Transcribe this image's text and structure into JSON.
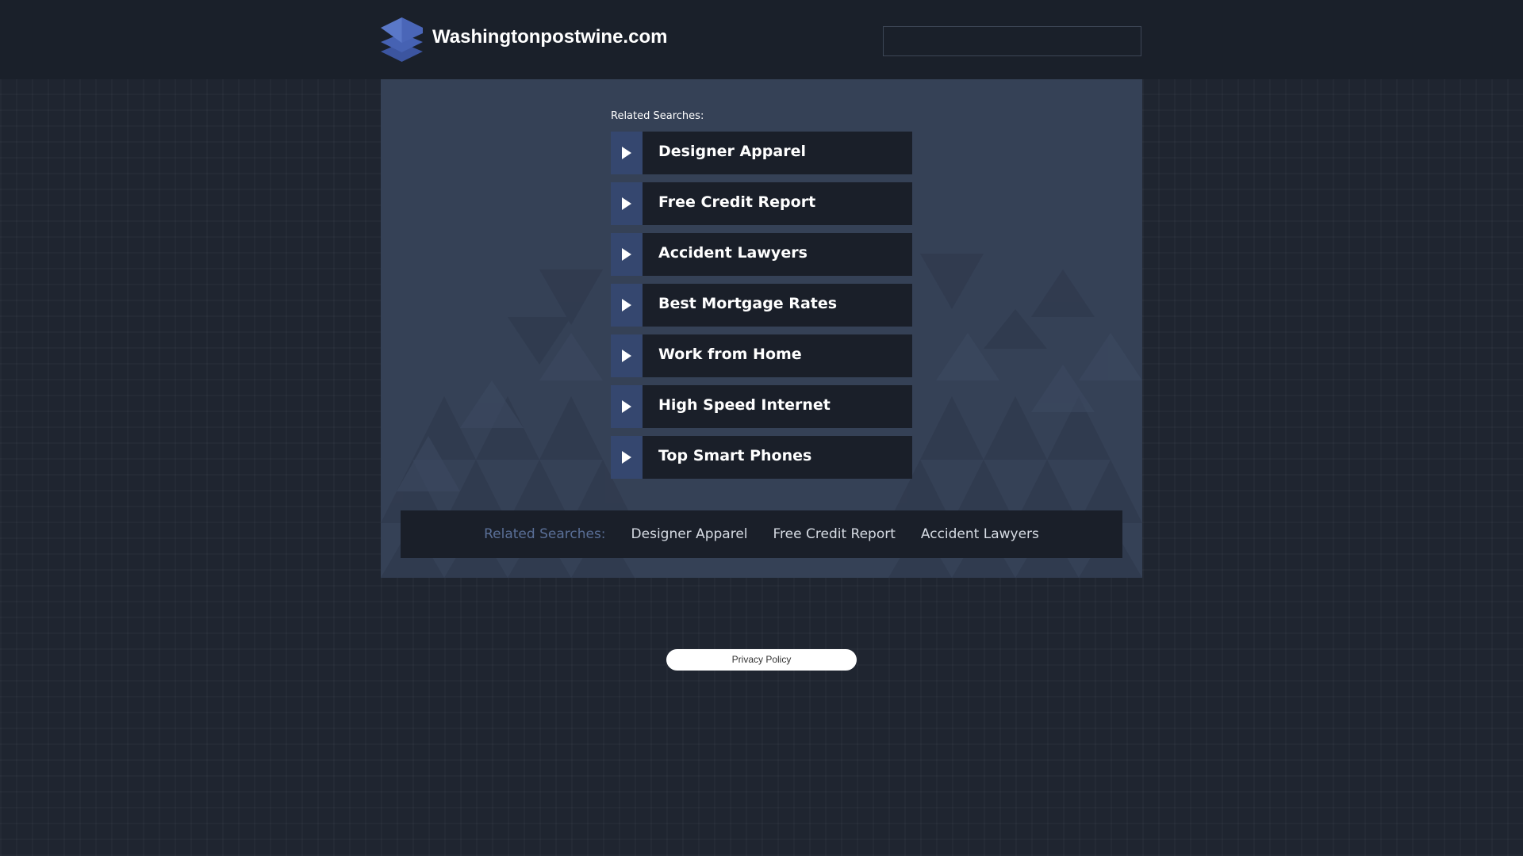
{
  "header": {
    "site_title": "Washingtonpostwine.com",
    "logo_icon": "stacked-layers-icon",
    "search_value": ""
  },
  "main": {
    "related_heading": "Related Searches:",
    "links": [
      {
        "label": "Designer Apparel",
        "icon": "play-arrow-icon"
      },
      {
        "label": "Free Credit Report",
        "icon": "play-arrow-icon"
      },
      {
        "label": "Accident Lawyers",
        "icon": "play-arrow-icon"
      },
      {
        "label": "Best Mortgage Rates",
        "icon": "play-arrow-icon"
      },
      {
        "label": "Work from Home",
        "icon": "play-arrow-icon"
      },
      {
        "label": "High Speed Internet",
        "icon": "play-arrow-icon"
      },
      {
        "label": "Top Smart Phones",
        "icon": "play-arrow-icon"
      }
    ]
  },
  "bottom_bar": {
    "heading": "Related Searches:",
    "links": [
      "Designer Apparel",
      "Free Credit Report",
      "Accident Lawyers"
    ]
  },
  "footer": {
    "privacy_label": "Privacy Policy"
  },
  "colors": {
    "page_bg": "#1f2530",
    "header_bg": "#1a202a",
    "panel_bg": "#354156",
    "link_bg": "#1a1f29",
    "arrow_box": "#35476f",
    "bottom_heading": "#5a6f97"
  }
}
